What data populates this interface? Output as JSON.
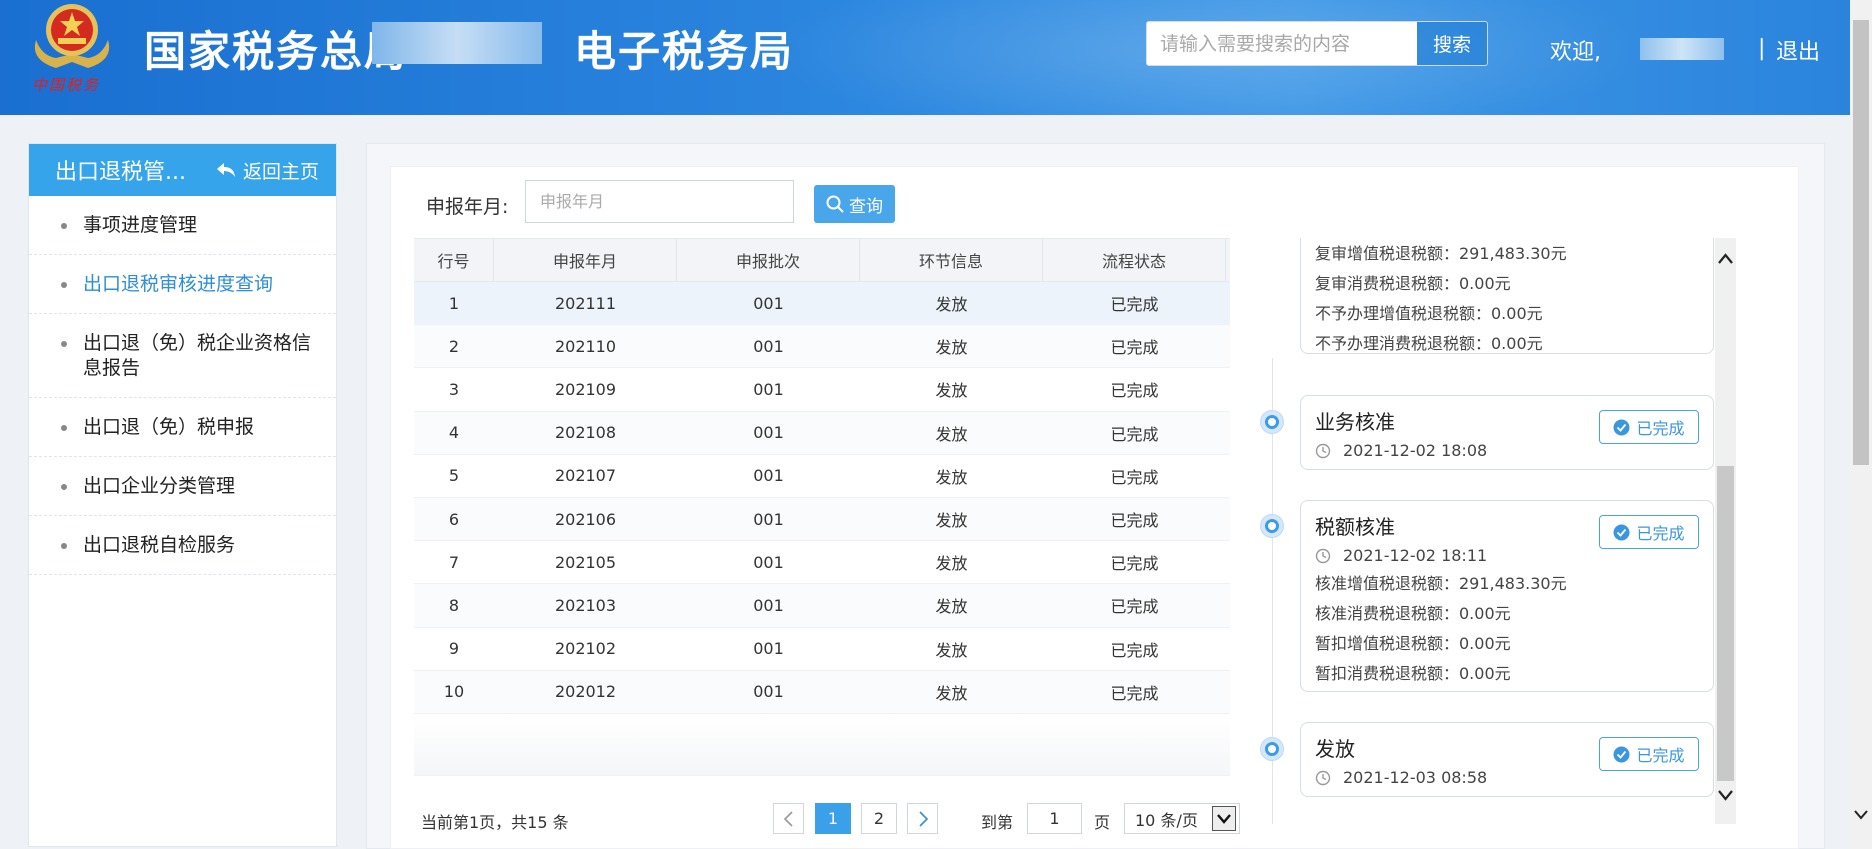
{
  "header": {
    "title_left": "国家税务总局",
    "title_right": "电子税务局",
    "emblem_caption": "中国税务",
    "search": {
      "placeholder": "请输入需要搜索的内容",
      "button": "搜索"
    },
    "welcome": "欢迎,",
    "separator": "|",
    "logout": "退出"
  },
  "sidebar": {
    "title": "出口退税管...",
    "back_label": "返回主页",
    "items": [
      {
        "label": "事项进度管理"
      },
      {
        "label": "出口退税审核进度查询"
      },
      {
        "label": "出口退（免）税企业资格信息报告"
      },
      {
        "label": "出口退（免）税申报"
      },
      {
        "label": "出口企业分类管理"
      },
      {
        "label": "出口退税自检服务"
      }
    ]
  },
  "filter": {
    "label": "申报年月:",
    "placeholder": "申报年月",
    "query_button": "查询"
  },
  "table": {
    "columns": [
      "行号",
      "申报年月",
      "申报批次",
      "环节信息",
      "流程状态"
    ],
    "rows": [
      [
        "1",
        "202111",
        "001",
        "发放",
        "已完成"
      ],
      [
        "2",
        "202110",
        "001",
        "发放",
        "已完成"
      ],
      [
        "3",
        "202109",
        "001",
        "发放",
        "已完成"
      ],
      [
        "4",
        "202108",
        "001",
        "发放",
        "已完成"
      ],
      [
        "5",
        "202107",
        "001",
        "发放",
        "已完成"
      ],
      [
        "6",
        "202106",
        "001",
        "发放",
        "已完成"
      ],
      [
        "7",
        "202105",
        "001",
        "发放",
        "已完成"
      ],
      [
        "8",
        "202103",
        "001",
        "发放",
        "已完成"
      ],
      [
        "9",
        "202102",
        "001",
        "发放",
        "已完成"
      ],
      [
        "10",
        "202012",
        "001",
        "发放",
        "已完成"
      ]
    ]
  },
  "pagination": {
    "info": "当前第1页，共15 条",
    "pages": [
      "1",
      "2"
    ],
    "goto_prefix": "到第",
    "goto_value": "1",
    "goto_suffix": "页",
    "page_size": "10 条/页"
  },
  "timeline": {
    "partial_card": {
      "lines": [
        "复审增值税退税额：291,483.30元",
        "复审消费税退税额：0.00元",
        "不予办理增值税退税额：0.00元",
        "不予办理消费税退税额：0.00元"
      ]
    },
    "cards": [
      {
        "title": "业务核准",
        "time": "2021-12-02 18:08",
        "status": "已完成",
        "lines": []
      },
      {
        "title": "税额核准",
        "time": "2021-12-02 18:11",
        "status": "已完成",
        "lines": [
          "核准增值税退税额：291,483.30元",
          "核准消费税退税额：0.00元",
          "暂扣增值税退税额：0.00元",
          "暂扣消费税退税额：0.00元"
        ]
      },
      {
        "title": "发放",
        "time": "2021-12-03 08:58",
        "status": "已完成",
        "lines": []
      }
    ]
  },
  "colors": {
    "header_blue": "#2b86df",
    "accent": "#36a4ea",
    "active_link": "#2f8fd6",
    "emblem_red": "#e02020"
  }
}
